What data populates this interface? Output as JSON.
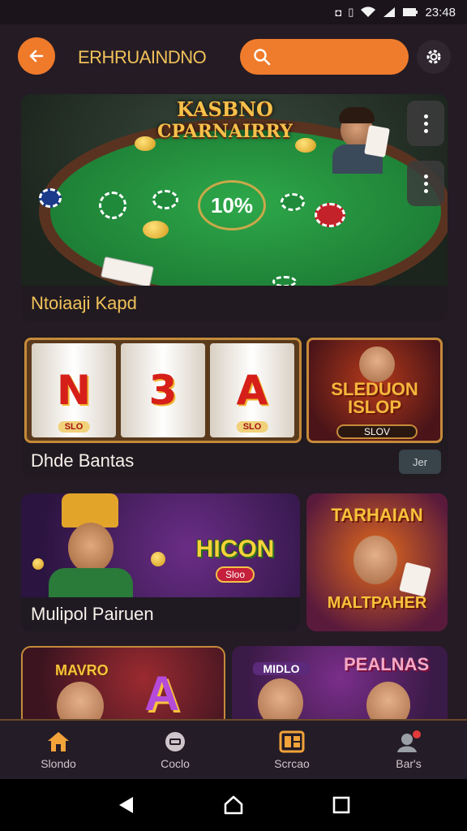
{
  "status_bar": {
    "time": "23:48"
  },
  "header": {
    "title": "ERHRUAINDNO",
    "search_placeholder": ""
  },
  "featured": {
    "title_line1": "KASBNO",
    "title_line2": "CPARNAIRRY",
    "pot_text": "10%",
    "footer_label": "Ntoiaaji Kapd"
  },
  "slots_section": {
    "reels": [
      {
        "symbol": "N",
        "tag": "SLO"
      },
      {
        "symbol": "3",
        "tag": ""
      },
      {
        "symbol": "A",
        "tag": "SLO"
      }
    ],
    "promo_title_l1": "SLEDUON",
    "promo_title_l2": "ISLOP",
    "promo_button": "SLOV",
    "footer_label": "Dhde Bantas",
    "bet_button": "Jer"
  },
  "multiplayer_section": {
    "logo_text": "HICON",
    "logo_badge": "Sloo",
    "footer_label": "Mulipol Pairuen",
    "promo_title": "TARHAIAN",
    "promo_subtitle": "MALTPAHER"
  },
  "row3": {
    "left_title": "MAVRO",
    "left_symbol": "A",
    "right_badge": "MIDLO",
    "right_title": "PEALNAS"
  },
  "bottom_nav": {
    "items": [
      {
        "label": "Slondo",
        "icon": "home-icon",
        "color": "#f2a33a"
      },
      {
        "label": "Coclo",
        "icon": "cards-icon",
        "color": "#cfc6cc"
      },
      {
        "label": "Scrcao",
        "icon": "grid-icon",
        "color": "#f2a33a"
      },
      {
        "label": "Bar's",
        "icon": "profile-icon",
        "color": "#cfc6cc"
      }
    ]
  },
  "colors": {
    "accent": "#ee7a2a",
    "background": "#241b24",
    "gold": "#f1c25a"
  }
}
